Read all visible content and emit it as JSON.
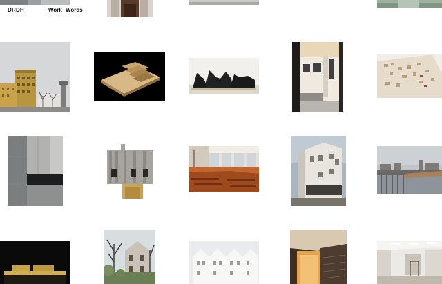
{
  "header": {
    "logo": "DRDH",
    "nav": [
      {
        "label": "Work"
      },
      {
        "label": "Words"
      }
    ]
  },
  "grid": {
    "projects": [
      {
        "image": "top-partial-interior-strip"
      },
      {
        "image": "top-partial-corridor"
      },
      {
        "image": "top-partial-grey-strip"
      },
      {
        "image": "top-partial-green-strip"
      },
      {
        "image": "city-street-with-tower"
      },
      {
        "image": "wooden-stepped-model"
      },
      {
        "image": "black-roofline-model"
      },
      {
        "image": "gallery-interior-paintings"
      },
      {
        "image": "site-plan-model"
      },
      {
        "image": "concrete-interior-wall"
      },
      {
        "image": "timber-facade-model"
      },
      {
        "image": "library-interior-orange"
      },
      {
        "image": "white-stone-building"
      },
      {
        "image": "waterfront-pier"
      },
      {
        "image": "dark-model-with-gold-base"
      },
      {
        "image": "villa-with-trees"
      },
      {
        "image": "white-gabled-facade-model"
      },
      {
        "image": "warm-interior-staircase"
      },
      {
        "image": "white-room-interior"
      }
    ]
  }
}
